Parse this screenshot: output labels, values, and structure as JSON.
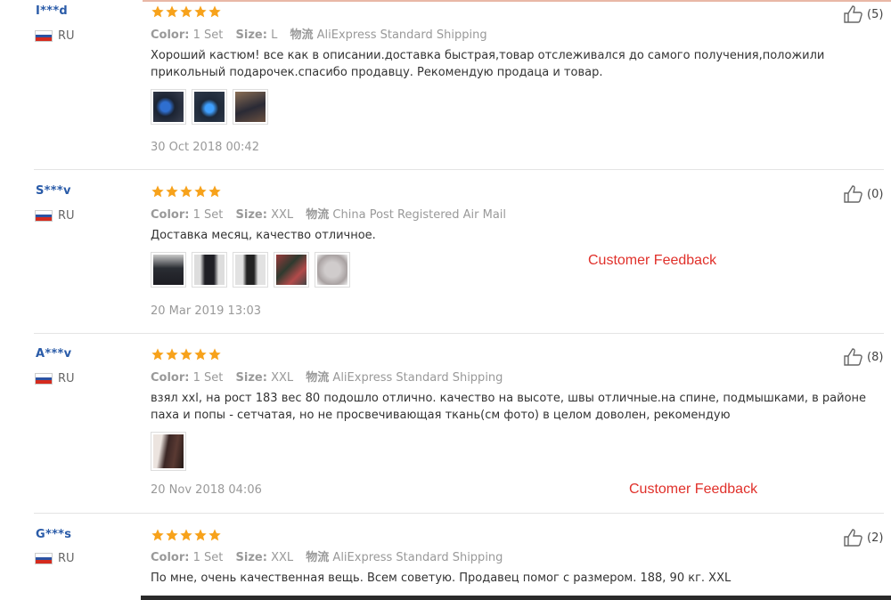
{
  "labels": {
    "color": "Color:",
    "size": "Size:",
    "shipping_glyph": "物流"
  },
  "watermark_text": "Customer Feedback",
  "reviews": [
    {
      "user": "I***d",
      "country": "RU",
      "rating": 5,
      "color": "1 Set",
      "size": "L",
      "shipping": "AliExpress Standard Shipping",
      "text": "Хороший кастюм! все как в описании.доставка быстрая,товар отслеживался до самого получения,положили прикольный подарочек.спасибо продавцу. Рекомендую продаца и товар.",
      "photos": 3,
      "date": "30 Oct 2018 00:42",
      "likes": "(5)"
    },
    {
      "user": "S***v",
      "country": "RU",
      "rating": 5,
      "color": "1 Set",
      "size": "XXL",
      "shipping": "China Post Registered Air Mail",
      "text": "Доставка месяц, качество отличное.",
      "photos": 5,
      "date": "20 Mar 2019 13:03",
      "likes": "(0)"
    },
    {
      "user": "A***v",
      "country": "RU",
      "rating": 5,
      "color": "1 Set",
      "size": "XXL",
      "shipping": "AliExpress Standard Shipping",
      "text": "взял xxl, на рост 183 вес 80 подошло отлично. качество на высоте, швы отличные.на спине, подмышками, в районе паха и попы - сетчатая, но не просвечивающая ткань(см фото) в целом доволен, рекомендую",
      "photos": 1,
      "date": "20 Nov 2018 04:06",
      "likes": "(8)"
    },
    {
      "user": "G***s",
      "country": "RU",
      "rating": 5,
      "color": "1 Set",
      "size": "XXL",
      "shipping": "AliExpress Standard Shipping",
      "text": "По мне, очень качественная вещь. Всем советую. Продавец помог с размером. 188, 90 кг. XXL",
      "likes": "(2)"
    }
  ]
}
